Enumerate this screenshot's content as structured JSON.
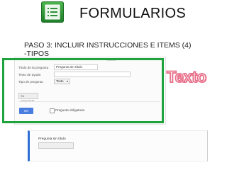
{
  "slide": {
    "title": "FORMULARIOS",
    "step_line1": "PASO 3: INCLUIR INSTRUCCIONES E ITEMS (4)",
    "step_line2": "-TIPOS",
    "callout": "Texto"
  },
  "editor": {
    "question_title_label": "Título de la pregunta",
    "question_title_value": "Pregunta sin título",
    "help_text_label": "Texto de ayuda",
    "help_text_value": "",
    "question_type_label": "Tipo de pregunta",
    "question_type_value": "Texto",
    "answer_preview": "Su respuesta",
    "ok_label": "OK",
    "required_label": "Pregunta obligatoria",
    "required_checked": false
  },
  "preview": {
    "question_label": "Pregunta sin título",
    "answer_value": ""
  },
  "colors": {
    "highlight": "#1fa33c",
    "callout_outline": "#e8708a",
    "ok_button": "#4a7de0",
    "preview_accent": "#2d6fd3"
  },
  "icons": {
    "app_icon": "google-forms-icon"
  }
}
